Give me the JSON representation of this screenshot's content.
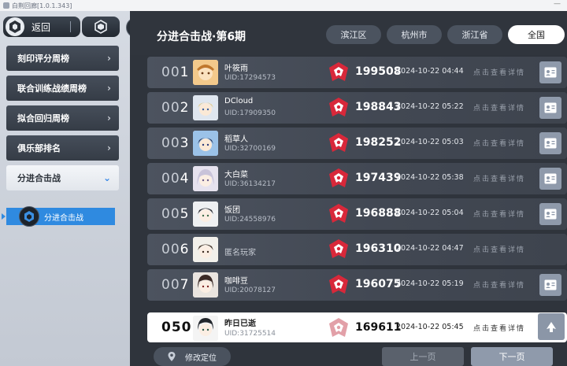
{
  "window": {
    "title": "白荆回廊[1.0.1.343]",
    "controls": "—"
  },
  "sidebar": {
    "back_label": "返回",
    "help_label": "?",
    "items": [
      {
        "label": "刻印评分周榜"
      },
      {
        "label": "联合训练战绩周榜"
      },
      {
        "label": "拟合回归周榜"
      },
      {
        "label": "俱乐部排名"
      },
      {
        "label": "分进合击战"
      }
    ],
    "sub_item": {
      "label": "分进合击战"
    }
  },
  "header": {
    "title": "分进合击战·第6期",
    "regions": [
      "滨江区",
      "杭州市",
      "浙江省",
      "全国"
    ],
    "active_region": "全国"
  },
  "rows": [
    {
      "rank_prefix": "00",
      "rank_digit": "1",
      "name": "叶筱雨",
      "uid": "UID:17294573",
      "score": "199508",
      "time": "2024-10-22 04:44",
      "detail": "点击查看详情"
    },
    {
      "rank_prefix": "00",
      "rank_digit": "2",
      "name": "DCloud",
      "uid": "UID:17909350",
      "score": "198843",
      "time": "2024-10-22 05:22",
      "detail": "点击查看详情"
    },
    {
      "rank_prefix": "00",
      "rank_digit": "3",
      "name": "稻草人",
      "uid": "UID:32700169",
      "score": "198252",
      "time": "2024-10-22 05:03",
      "detail": "点击查看详情"
    },
    {
      "rank_prefix": "00",
      "rank_digit": "4",
      "name": "大白菜",
      "uid": "UID:36134217",
      "score": "197439",
      "time": "2024-10-22 05:38",
      "detail": "点击查看详情"
    },
    {
      "rank_prefix": "00",
      "rank_digit": "5",
      "name": "饭团",
      "uid": "UID:24558976",
      "score": "196888",
      "time": "2024-10-22 05:04",
      "detail": "点击查看详情"
    },
    {
      "rank_prefix": "00",
      "rank_digit": "6",
      "name": "匿名玩家",
      "uid": "",
      "score": "196310",
      "time": "2024-10-22 04:47",
      "detail": "点击查看详情"
    },
    {
      "rank_prefix": "00",
      "rank_digit": "7",
      "name": "咖啡豆",
      "uid": "UID:20078127",
      "score": "196075",
      "time": "2024-10-22 05:19",
      "detail": "点击查看详情"
    }
  ],
  "my_row": {
    "rank": "050",
    "name": "昨日已逝",
    "uid": "UID:31725514",
    "score": "169611",
    "time": "2024-10-22 05:45",
    "detail": "点击查看详情"
  },
  "footer": {
    "locate_label": "修改定位",
    "prev_label": "上一页",
    "next_label": "下一页"
  },
  "colors": {
    "accent_blue": "#2f8ae0",
    "badge_red": "#d8283a",
    "card_btn": "#8f9aab"
  }
}
